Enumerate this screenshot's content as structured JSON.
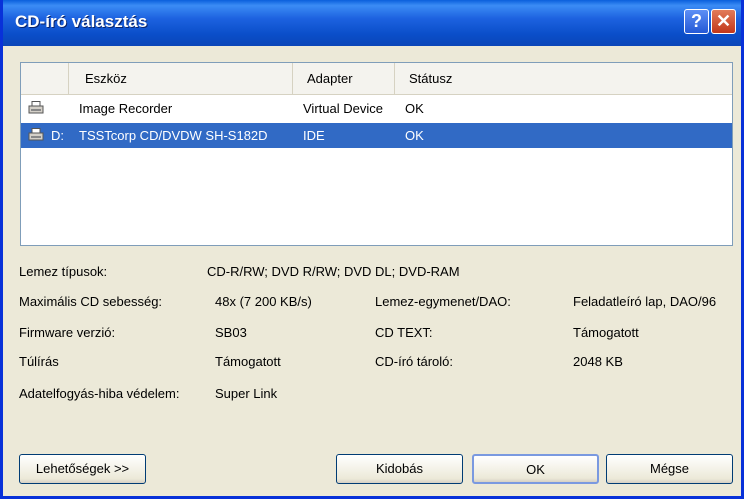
{
  "window": {
    "title": "CD-író választás",
    "help_glyph": "?",
    "close_glyph": "✕"
  },
  "device_list": {
    "columns": [
      "Eszköz",
      "Adapter",
      "Státusz"
    ],
    "rows": [
      {
        "drive": "",
        "device": "Image Recorder",
        "adapter": "Virtual Device",
        "status": "OK",
        "selected": false
      },
      {
        "drive": "D:",
        "device": "TSSTcorp CD/DVDW SH-S182D",
        "adapter": "IDE",
        "status": "OK",
        "selected": true
      }
    ]
  },
  "info": {
    "disc_types_label": "Lemez típusok:",
    "disc_types_value": "CD-R/RW; DVD R/RW; DVD DL; DVD-RAM",
    "max_speed_label": "Maximális CD sebesség:",
    "max_speed_value": "48x (7 200 KB/s)",
    "dao_label": "Lemez-egymenet/DAO:",
    "dao_value": "Feladatleíró lap, DAO/96",
    "firmware_label": "Firmware verzió:",
    "firmware_value": "SB03",
    "cdtext_label": "CD TEXT:",
    "cdtext_value": "Támogatott",
    "overburn_label": "Túlírás",
    "overburn_value": "Támogatott",
    "buffer_label": "CD-író tároló:",
    "buffer_value": "2048 KB",
    "underrun_label": "Adatelfogyás-hiba védelem:",
    "underrun_value": "Super Link"
  },
  "buttons": {
    "options": "Lehetőségek >>",
    "eject": "Kidobás",
    "ok": "OK",
    "cancel": "Mégse"
  }
}
